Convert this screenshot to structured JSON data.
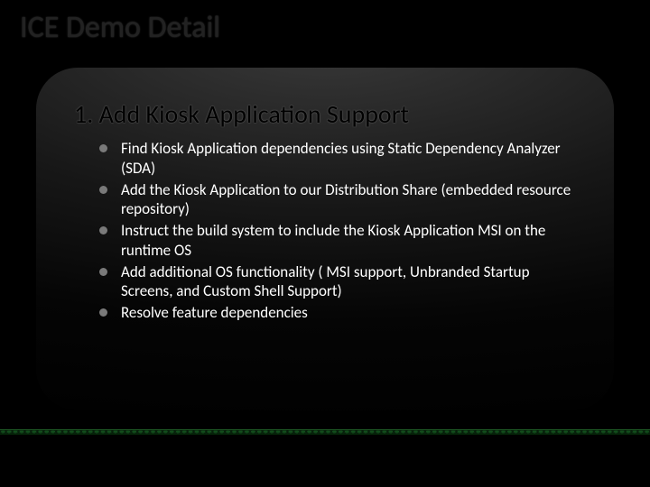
{
  "title": "ICE Demo Detail",
  "panel": {
    "heading": "1. Add Kiosk Application Support",
    "bullets": [
      "Find Kiosk Application dependencies using Static Dependency Analyzer (SDA)",
      "Add the Kiosk Application to our Distribution Share (embedded resource repository)",
      "Instruct the build system to include the Kiosk Application MSI on the runtime OS",
      "Add additional OS functionality ( MSI support, Unbranded Startup Screens, and Custom Shell Support)",
      "Resolve feature dependencies"
    ]
  }
}
